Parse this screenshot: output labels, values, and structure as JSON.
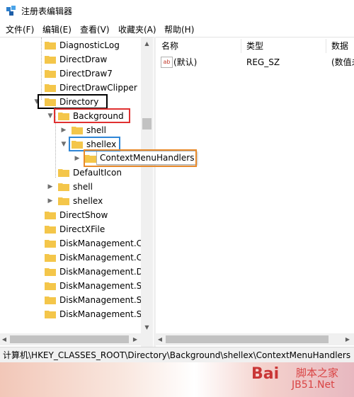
{
  "window": {
    "title": "注册表编辑器"
  },
  "menu": [
    "文件(F)",
    "编辑(E)",
    "查看(V)",
    "收藏夹(A)",
    "帮助(H)"
  ],
  "tree": [
    {
      "label": "DiagnosticLog"
    },
    {
      "label": "DirectDraw"
    },
    {
      "label": "DirectDraw7"
    },
    {
      "label": "DirectDrawClipper"
    },
    {
      "label": "Directory"
    },
    {
      "label": "Background"
    },
    {
      "label": "shell"
    },
    {
      "label": "shellex"
    },
    {
      "label": "ContextMenuHandlers"
    },
    {
      "label": "DefaultIcon"
    },
    {
      "label": "shell"
    },
    {
      "label": "shellex"
    },
    {
      "label": "DirectShow"
    },
    {
      "label": "DirectXFile"
    },
    {
      "label": "DiskManagement.C"
    },
    {
      "label": "DiskManagement.C"
    },
    {
      "label": "DiskManagement.D"
    },
    {
      "label": "DiskManagement.S"
    },
    {
      "label": "DiskManagement.S"
    },
    {
      "label": "DiskManagement.S"
    }
  ],
  "tooltip": "ContextMenuHandlers",
  "list": {
    "columns": [
      "名称",
      "类型",
      "数据"
    ],
    "rows": [
      {
        "name": "(默认)",
        "type": "REG_SZ",
        "data": "(数值未"
      }
    ]
  },
  "icon": {
    "value": "ab"
  },
  "status": "计算机\\HKEY_CLASSES_ROOT\\Directory\\Background\\shellex\\ContextMenuHandlers",
  "watermark": {
    "brand": "Bai",
    "sub": "脚本之家",
    "site": "JB51.Net"
  },
  "colors": {
    "highlight_black": "#000000",
    "highlight_red": "#e03030",
    "highlight_blue": "#2f86d6",
    "highlight_orange": "#e88a2b",
    "folder": "#f4c64a"
  }
}
